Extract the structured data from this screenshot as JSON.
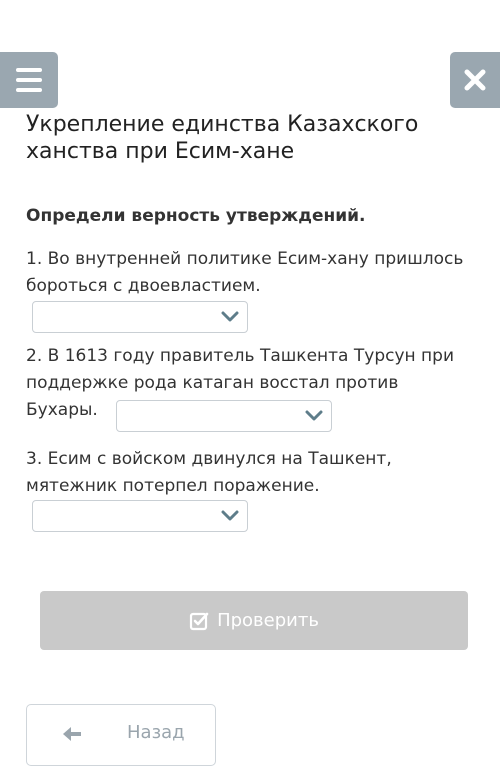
{
  "header": {
    "menu_icon": "hamburger-menu-icon",
    "close_icon": "close-icon"
  },
  "title": "Укрепление единства Казахского ханства при Есим-хане",
  "instruction": "Определи верность утверждений.",
  "statements": [
    {
      "text": "1. Во внутренней политике Есим-хану пришлось бороться с двоевластием.",
      "selected": ""
    },
    {
      "text": "2. В 1613 году правитель Ташкента Турсун при поддержке рода катаган восстал против Бухары.",
      "selected": ""
    },
    {
      "text": "3. Есим с войском двинулся на Ташкент, мятежник потерпел поражение.",
      "selected": ""
    }
  ],
  "check_button": {
    "label": "Проверить",
    "icon": "check-square-icon"
  },
  "back_button": {
    "label": "Назад",
    "icon": "arrow-left-icon"
  },
  "colors": {
    "nav_button_bg": "#9aa7b0",
    "check_button_bg": "#c9c9c9",
    "chevron": "#5e7d8a",
    "back_text": "#9aa5ad"
  }
}
